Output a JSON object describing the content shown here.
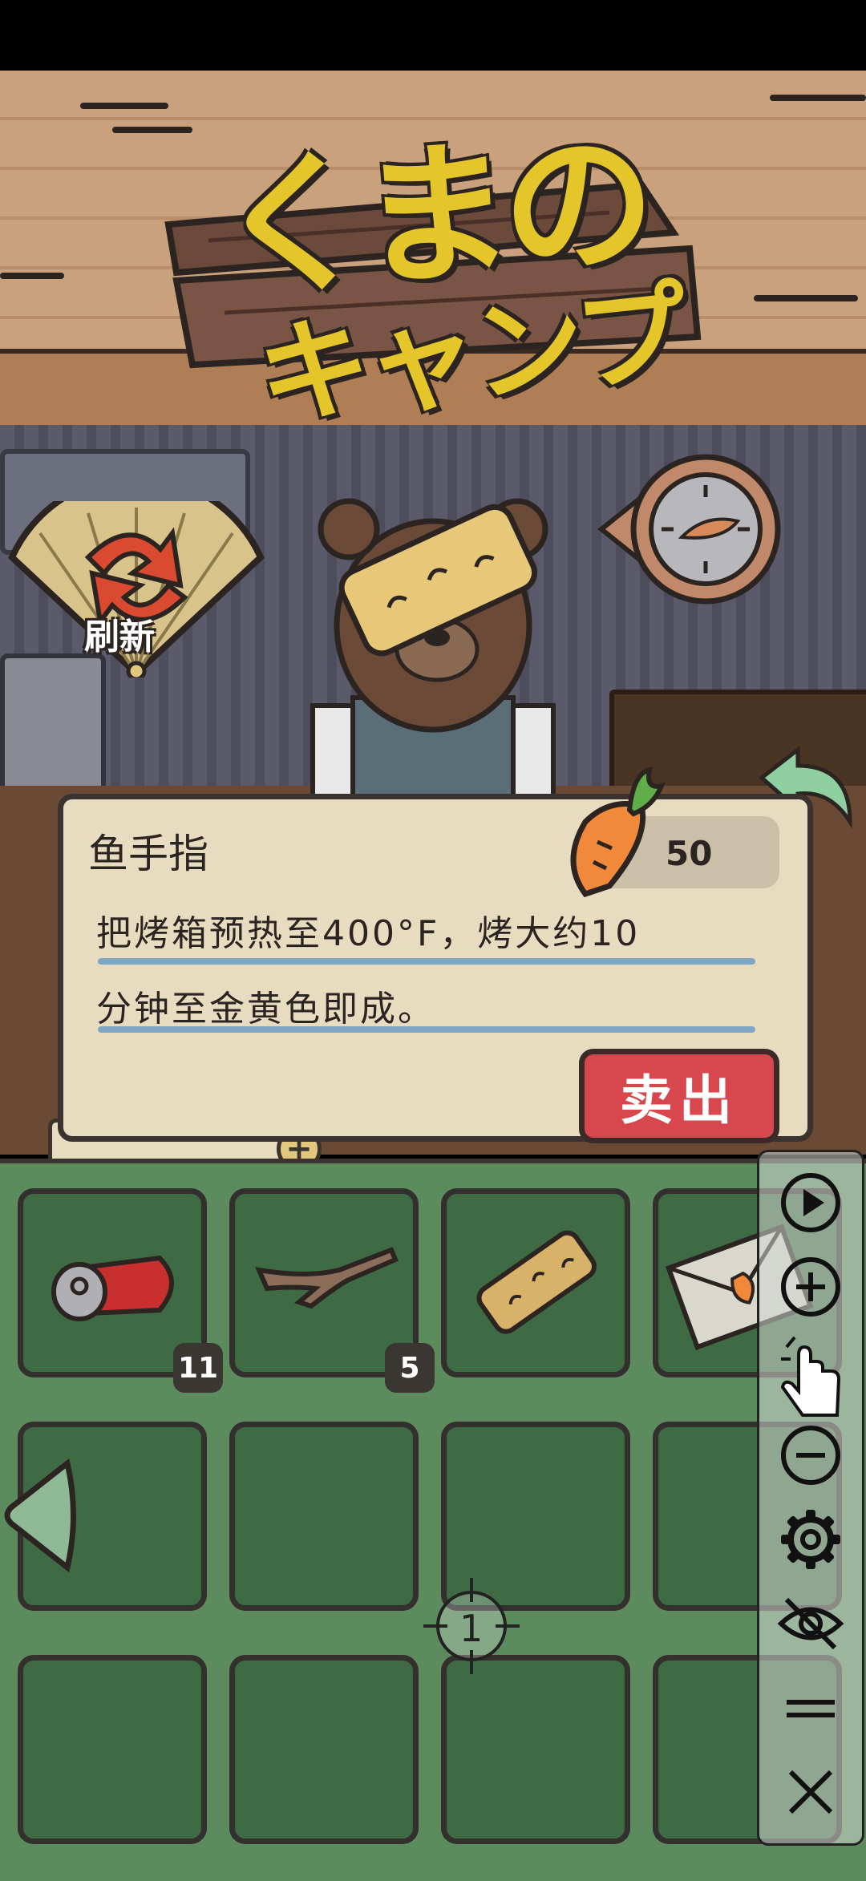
{
  "header": {
    "logo_line1": "くまの",
    "logo_line2": "キャンプ"
  },
  "refresh": {
    "label": "刷新"
  },
  "dialog": {
    "item_name": "鱼手指",
    "price": "50",
    "description_line1": "把烤箱预热至400°F，烤大约10",
    "description_line2": "分钟至金黄色即成。",
    "sell_label": "卖出"
  },
  "inventory": {
    "slots": [
      {
        "item": "crushed-can",
        "count": "11"
      },
      {
        "item": "wood-branch",
        "count": "5"
      },
      {
        "item": "fish-finger",
        "count": ""
      },
      {
        "item": "letter-envelope",
        "count": ""
      }
    ]
  },
  "crosshair": {
    "label": "1"
  },
  "toolbar": {
    "items": [
      "play-icon",
      "zoom-in-icon",
      "tap-hand-icon",
      "zoom-out-icon",
      "settings-icon",
      "hide-eye-icon",
      "menu-icon",
      "close-icon"
    ]
  },
  "colors": {
    "sell_button": "#d9474e",
    "dialog_bg": "#e8dcc0",
    "inventory_bg": "#5c8c5e",
    "logo_yellow": "#e4c52a"
  }
}
